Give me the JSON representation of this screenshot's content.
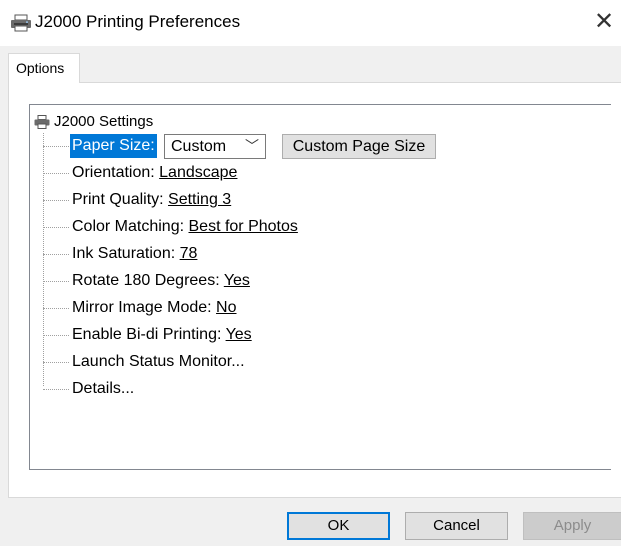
{
  "window": {
    "title": "J2000 Printing Preferences",
    "close_glyph": "✕",
    "icon": "printer-icon"
  },
  "tabs": [
    {
      "label": "Options",
      "active": true
    }
  ],
  "tree": {
    "root_label": "J2000 Settings",
    "root_icon": "printer-icon",
    "items": [
      {
        "label": "Paper Size:",
        "value": "",
        "selected": true
      },
      {
        "label": "Orientation: ",
        "value": "Landscape"
      },
      {
        "label": "Print Quality: ",
        "value": "Setting 3"
      },
      {
        "label": "Color Matching: ",
        "value": "Best for Photos"
      },
      {
        "label": "Ink Saturation: ",
        "value": "78"
      },
      {
        "label": "Rotate 180 Degrees: ",
        "value": "Yes"
      },
      {
        "label": "Mirror Image Mode: ",
        "value": "No"
      },
      {
        "label": "Enable Bi-di Printing: ",
        "value": "Yes"
      },
      {
        "label": "Launch Status Monitor...",
        "value": ""
      },
      {
        "label": "Details...",
        "value": ""
      }
    ],
    "paper_size_select": {
      "value": "Custom",
      "chevron": "﹀"
    },
    "custom_page_size_button": "Custom Page Size"
  },
  "buttons": {
    "ok": "OK",
    "cancel": "Cancel",
    "apply": "Apply",
    "apply_enabled": false
  },
  "colors": {
    "selection": "#0078d7",
    "window_bg": "#f0f0f0",
    "panel_bg": "#ffffff"
  }
}
